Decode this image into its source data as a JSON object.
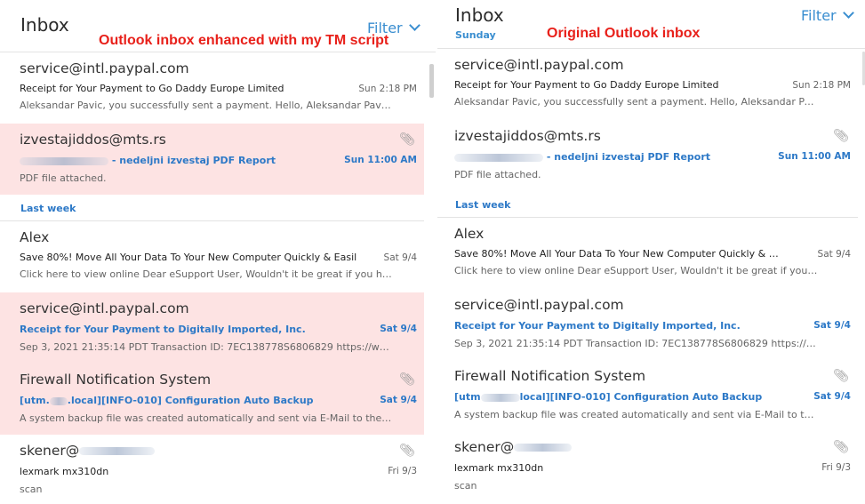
{
  "left": {
    "title": "Inbox",
    "filter_label": "Filter",
    "caption": "Outlook inbox enhanced with my TM script",
    "messages_top": [
      {
        "sender": "service@intl.paypal.com",
        "subject": "Receipt for Your Payment to Go Daddy Europe Limited",
        "date": "Sun 2:18 PM",
        "preview": "Aleksandar Pavic, you successfully sent a payment. Hello, Aleksandar Pavic Yo..."
      },
      {
        "sender": "izvestajiddos@mts.rs",
        "subject": "- nedeljni izvestaj PDF Report",
        "date": "Sun 11:00 AM",
        "preview": "PDF file attached."
      }
    ],
    "group_label": "Last week",
    "messages_week": [
      {
        "sender": "Alex",
        "subject": "Save 80%! Move All Your Data To Your New Computer Quickly & Easil",
        "date": "Sat 9/4",
        "preview": "Click here to view online Dear eSupport User, Wouldn't it be great if you had ..."
      },
      {
        "sender": "service@intl.paypal.com",
        "subject": "Receipt for Your Payment to Digitally Imported, Inc.",
        "date": "Sat 9/4",
        "preview": "Sep 3, 2021 21:35:14 PDT Transaction ID: 7EC138778S6806829 https://www.pay..."
      },
      {
        "sender": "Firewall Notification System",
        "subject_pre": "[utm.",
        "subject_post": ".local][INFO-010] Configuration Auto Backup",
        "date": "Sat 9/4",
        "preview": "A system backup file was created automatically and sent via E-Mail to the ad..."
      },
      {
        "sender": "skener@",
        "subject": "lexmark mx310dn",
        "date": "Fri 9/3",
        "preview": "scan"
      }
    ]
  },
  "right": {
    "title": "Inbox",
    "subheading": "Sunday",
    "filter_label": "Filter",
    "caption": "Original Outlook inbox",
    "messages_top": [
      {
        "sender": "service@intl.paypal.com",
        "subject": "Receipt for Your Payment to Go Daddy Europe Limited",
        "date": "Sun 2:18 PM",
        "preview": "Aleksandar Pavic, you successfully sent a payment. Hello, Aleksandar Pavic Yo..."
      },
      {
        "sender": "izvestajiddos@mts.rs",
        "subject": "- nedeljni izvestaj PDF Report",
        "date": "Sun 11:00 AM",
        "preview": "PDF file attached."
      }
    ],
    "group_label": "Last week",
    "messages_week": [
      {
        "sender": "Alex",
        "subject": "Save 80%! Move All Your Data To Your New Computer Quickly & Easil",
        "date": "Sat 9/4",
        "preview": "Click here to view online Dear eSupport User, Wouldn't it be great if you had ..."
      },
      {
        "sender": "service@intl.paypal.com",
        "subject": "Receipt for Your Payment to Digitally Imported, Inc.",
        "date": "Sat 9/4",
        "preview": "Sep 3, 2021 21:35:14 PDT Transaction ID: 7EC138778S6806829 https://www.pay..."
      },
      {
        "sender": "Firewall Notification System",
        "subject_pre": "[utm",
        "subject_post": "local][INFO-010] Configuration Auto Backup",
        "date": "Sat 9/4",
        "preview": "A system backup file was created automatically and sent via E-Mail to the ad..."
      },
      {
        "sender": "skener@",
        "subject": "lexmark mx310dn",
        "date": "Fri 9/3",
        "preview": "scan"
      }
    ]
  },
  "icons": {
    "attachment": "paperclip-icon",
    "filter_chevron": "chevron-down-icon"
  },
  "colors": {
    "accent": "#3a8ed0",
    "highlight": "#fde3e3",
    "caption": "#e8201a"
  }
}
